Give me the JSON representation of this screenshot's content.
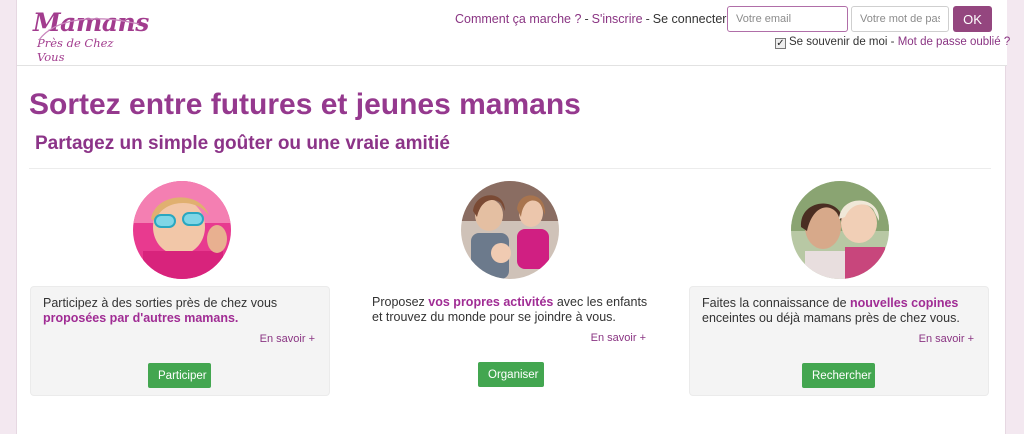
{
  "header": {
    "logo_line1": "Mamans",
    "logo_line2": "Près de Chez Vous",
    "how_it_works": "Comment ça marche ?",
    "sep1": "-",
    "signup": "S'inscrire",
    "sep2": "-",
    "login_label": "Se connecter",
    "email_placeholder": "Votre email",
    "password_placeholder": "Votre mot de passe",
    "ok": "OK",
    "remember": "Se souvenir de moi",
    "sep3": "-",
    "forgot": "Mot de passe oublié ?"
  },
  "main": {
    "title": "Sortez entre futures et jeunes mamans",
    "subtitle": "Partagez un simple goûter ou une vraie amitié"
  },
  "features": [
    {
      "text_a": "Participez à des sorties près de chez vous",
      "text_b": "proposées par d'autres mamans.",
      "more": "En savoir +",
      "button": "Participer"
    },
    {
      "text_a": "Proposez",
      "text_b": "vos propres activités",
      "text_c": "avec les enfants et trouvez du monde pour se joindre à vous.",
      "more": "En savoir +",
      "button": "Organiser"
    },
    {
      "text_a": "Faites la connaissance de",
      "text_b": "nouvelles copines",
      "text_c": "enceintes ou déjà mamans près de chez vous.",
      "more": "En savoir +",
      "button": "Rechercher"
    }
  ],
  "colors": {
    "brand": "#95398e",
    "button_green": "#43a650",
    "ok_button": "#94467f"
  }
}
